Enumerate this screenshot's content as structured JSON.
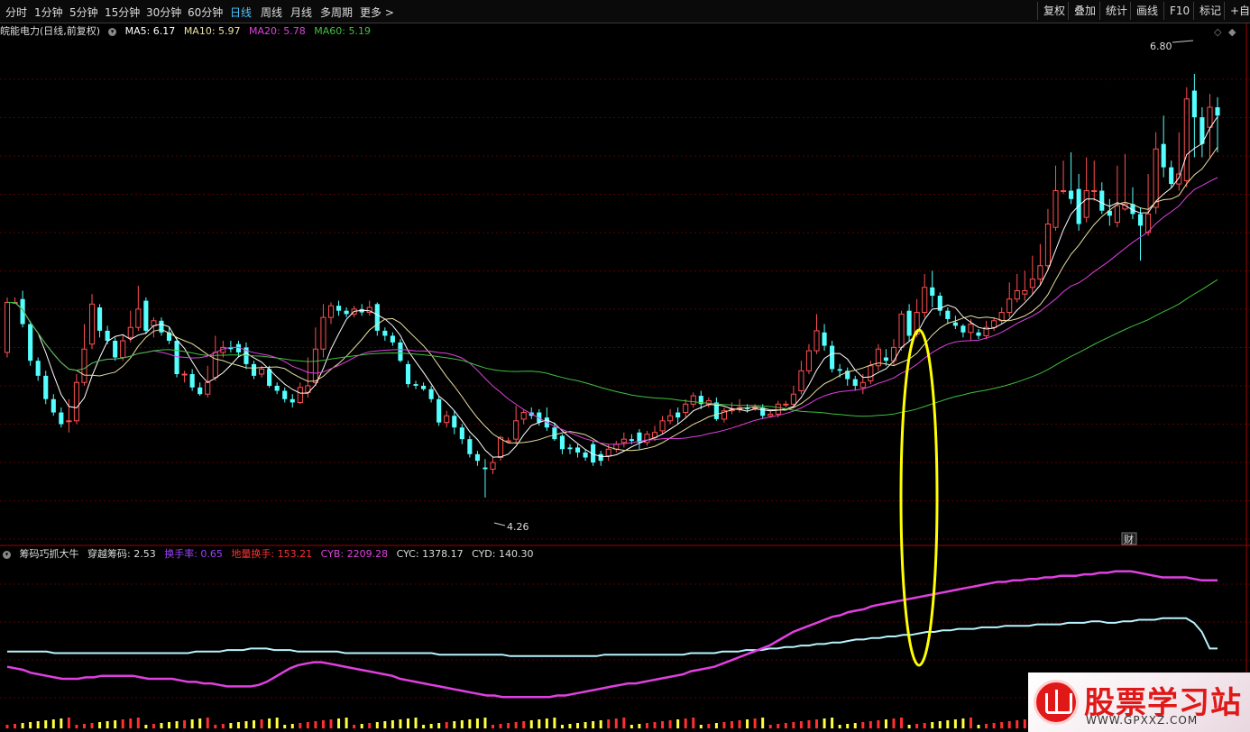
{
  "toolbar": {
    "periods": [
      "分时",
      "1分钟",
      "5分钟",
      "15分钟",
      "30分钟",
      "60分钟",
      "日线",
      "周线",
      "月线",
      "多周期",
      "更多 >"
    ],
    "active_period": "日线",
    "right_buttons": [
      "复权",
      "叠加",
      "统计",
      "画线",
      "F10",
      "标记",
      "+自选"
    ]
  },
  "chart_header": {
    "stock": "皖能电力(日线,前复权)",
    "ma_labels": [
      "MA5: 6.17",
      "MA10: 5.97",
      "MA20: 5.78",
      "MA60: 5.19"
    ],
    "colors": {
      "ma5": "#ffffff",
      "ma10": "#e8e0a0",
      "ma20": "#e040e0",
      "ma60": "#40c040"
    }
  },
  "indicator_header": {
    "name": "筹码巧抓大牛",
    "items": [
      {
        "label": "穿越筹码: ",
        "value": "2.53",
        "color": "#dddddd"
      },
      {
        "label": "换手率: ",
        "value": "0.65",
        "color": "#a040ff"
      },
      {
        "label": "地量换手: ",
        "value": "153.21",
        "color": "#ff3030"
      },
      {
        "label": "CYB: ",
        "value": "2209.28",
        "color": "#e040e0"
      },
      {
        "label": "CYC: ",
        "value": "1378.17",
        "color": "#dddddd"
      },
      {
        "label": "CYD: ",
        "value": "140.30",
        "color": "#dddddd"
      }
    ]
  },
  "annotations": {
    "high_label": "6.80",
    "low_label": "4.26",
    "finance_marker": "财"
  },
  "logo": {
    "name": "股票学习站",
    "url": "WWW.GPXXZ.COM"
  },
  "chart_data": {
    "type": "candlestick",
    "title": "皖能电力(日线,前复权)",
    "price_range": [
      4.0,
      7.0
    ],
    "colors": {
      "up": "#ff5050",
      "down": "#54ffff"
    },
    "candles": [
      [
        5.13,
        5.43,
        5.46,
        5.1
      ],
      [
        5.43,
        5.43,
        5.46,
        5.43
      ],
      [
        5.45,
        5.3,
        5.5,
        5.28
      ],
      [
        5.3,
        5.08,
        5.32,
        5.05
      ],
      [
        5.08,
        4.99,
        5.1,
        4.96
      ],
      [
        4.99,
        4.85,
        5.02,
        4.82
      ],
      [
        4.85,
        4.77,
        4.88,
        4.75
      ],
      [
        4.77,
        4.7,
        4.8,
        4.68
      ],
      [
        4.72,
        4.72,
        4.85,
        4.65
      ],
      [
        4.72,
        4.95,
        5.0,
        4.7
      ],
      [
        4.95,
        5.15,
        5.3,
        4.93
      ],
      [
        5.18,
        5.42,
        5.48,
        5.15
      ],
      [
        5.4,
        5.26,
        5.42,
        5.22
      ],
      [
        5.26,
        5.2,
        5.29,
        5.18
      ],
      [
        5.2,
        5.1,
        5.22,
        5.08
      ],
      [
        5.1,
        5.2,
        5.24,
        5.08
      ],
      [
        5.22,
        5.28,
        5.38,
        5.19
      ],
      [
        5.28,
        5.39,
        5.53,
        5.26
      ],
      [
        5.44,
        5.26,
        5.46,
        5.24
      ],
      [
        5.29,
        5.32,
        5.34,
        5.22
      ],
      [
        5.32,
        5.25,
        5.34,
        5.23
      ],
      [
        5.25,
        5.2,
        5.28,
        5.18
      ],
      [
        5.2,
        5.0,
        5.22,
        4.98
      ],
      [
        5.0,
        5.0,
        5.02,
        4.95
      ],
      [
        5.0,
        4.92,
        5.03,
        4.9
      ],
      [
        4.92,
        4.88,
        4.95,
        4.87
      ],
      [
        4.88,
        4.95,
        5.05,
        4.86
      ],
      [
        4.98,
        5.13,
        5.23,
        4.96
      ],
      [
        5.13,
        5.16,
        5.2,
        5.1
      ],
      [
        5.16,
        5.15,
        5.2,
        5.13
      ],
      [
        5.18,
        5.13,
        5.2,
        5.1
      ],
      [
        5.16,
        5.06,
        5.19,
        5.03
      ],
      [
        5.06,
        4.99,
        5.08,
        4.97
      ],
      [
        5.0,
        5.03,
        5.05,
        4.98
      ],
      [
        5.03,
        4.93,
        5.05,
        4.92
      ],
      [
        4.93,
        4.9,
        4.95,
        4.88
      ],
      [
        4.9,
        4.85,
        4.92,
        4.83
      ],
      [
        4.85,
        4.83,
        4.88,
        4.8
      ],
      [
        4.83,
        4.92,
        4.95,
        4.82
      ],
      [
        4.89,
        4.93,
        5.1,
        4.86
      ],
      [
        4.95,
        5.15,
        5.28,
        4.93
      ],
      [
        5.15,
        5.34,
        5.42,
        5.1
      ],
      [
        5.34,
        5.41,
        5.43,
        5.3
      ],
      [
        5.41,
        5.38,
        5.44,
        5.35
      ],
      [
        5.38,
        5.36,
        5.4,
        5.34
      ],
      [
        5.36,
        5.39,
        5.41,
        5.34
      ],
      [
        5.39,
        5.37,
        5.42,
        5.35
      ],
      [
        5.37,
        5.4,
        5.44,
        5.35
      ],
      [
        5.42,
        5.26,
        5.43,
        5.23
      ],
      [
        5.26,
        5.23,
        5.28,
        5.2
      ],
      [
        5.23,
        5.19,
        5.25,
        5.17
      ],
      [
        5.19,
        5.08,
        5.21,
        5.07
      ],
      [
        5.06,
        4.94,
        5.08,
        4.92
      ],
      [
        4.94,
        4.93,
        4.96,
        4.91
      ],
      [
        4.93,
        4.91,
        4.95,
        4.9
      ],
      [
        4.91,
        4.85,
        4.93,
        4.83
      ],
      [
        4.85,
        4.71,
        4.87,
        4.69
      ],
      [
        4.71,
        4.75,
        4.78,
        4.68
      ],
      [
        4.75,
        4.68,
        4.78,
        4.64
      ],
      [
        4.68,
        4.61,
        4.7,
        4.58
      ],
      [
        4.61,
        4.52,
        4.63,
        4.5
      ],
      [
        4.52,
        4.48,
        4.54,
        4.45
      ],
      [
        4.44,
        4.43,
        4.49,
        4.26
      ],
      [
        4.43,
        4.47,
        4.5,
        4.4
      ],
      [
        4.5,
        4.62,
        4.63,
        4.48
      ],
      [
        4.6,
        4.6,
        4.62,
        4.59
      ],
      [
        4.61,
        4.72,
        4.81,
        4.58
      ],
      [
        4.73,
        4.77,
        4.79,
        4.7
      ],
      [
        4.77,
        4.75,
        4.8,
        4.73
      ],
      [
        4.77,
        4.71,
        4.79,
        4.69
      ],
      [
        4.74,
        4.68,
        4.8,
        4.66
      ],
      [
        4.68,
        4.61,
        4.71,
        4.6
      ],
      [
        4.63,
        4.55,
        4.64,
        4.52
      ],
      [
        4.56,
        4.55,
        4.58,
        4.52
      ],
      [
        4.56,
        4.53,
        4.58,
        4.5
      ],
      [
        4.53,
        4.5,
        4.55,
        4.48
      ],
      [
        4.58,
        4.47,
        4.6,
        4.45
      ],
      [
        4.52,
        4.48,
        4.54,
        4.45
      ],
      [
        4.51,
        4.55,
        4.58,
        4.48
      ],
      [
        4.55,
        4.58,
        4.6,
        4.53
      ],
      [
        4.59,
        4.61,
        4.65,
        4.56
      ],
      [
        4.61,
        4.6,
        4.64,
        4.58
      ],
      [
        4.65,
        4.59,
        4.67,
        4.55
      ],
      [
        4.59,
        4.64,
        4.66,
        4.57
      ],
      [
        4.62,
        4.65,
        4.69,
        4.6
      ],
      [
        4.66,
        4.72,
        4.75,
        4.64
      ],
      [
        4.72,
        4.75,
        4.79,
        4.7
      ],
      [
        4.77,
        4.74,
        4.8,
        4.7
      ],
      [
        4.77,
        4.82,
        4.85,
        4.74
      ],
      [
        4.82,
        4.87,
        4.89,
        4.8
      ],
      [
        4.87,
        4.82,
        4.9,
        4.79
      ],
      [
        4.82,
        4.84,
        4.86,
        4.8
      ],
      [
        4.83,
        4.73,
        4.86,
        4.72
      ],
      [
        4.73,
        4.78,
        4.8,
        4.71
      ],
      [
        4.78,
        4.79,
        4.83,
        4.76
      ],
      [
        4.79,
        4.8,
        4.85,
        4.77
      ],
      [
        4.8,
        4.79,
        4.82,
        4.77
      ],
      [
        4.8,
        4.8,
        4.82,
        4.78
      ],
      [
        4.8,
        4.75,
        4.82,
        4.73
      ],
      [
        4.75,
        4.76,
        4.78,
        4.74
      ],
      [
        4.76,
        4.82,
        4.84,
        4.74
      ],
      [
        4.82,
        4.82,
        4.84,
        4.8
      ],
      [
        4.82,
        4.88,
        4.93,
        4.8
      ],
      [
        4.9,
        5.02,
        5.08,
        4.88
      ],
      [
        5.02,
        5.14,
        5.18,
        5.0
      ],
      [
        5.14,
        5.26,
        5.36,
        5.12
      ],
      [
        5.25,
        5.17,
        5.3,
        5.14
      ],
      [
        5.17,
        5.03,
        5.2,
        5.01
      ],
      [
        5.03,
        5.02,
        5.06,
        4.98
      ],
      [
        5.02,
        4.97,
        5.04,
        4.93
      ],
      [
        4.97,
        4.93,
        4.99,
        4.9
      ],
      [
        4.92,
        4.95,
        5.0,
        4.88
      ],
      [
        4.96,
        5.05,
        5.08,
        4.94
      ],
      [
        5.05,
        5.15,
        5.18,
        5.02
      ],
      [
        5.1,
        5.08,
        5.15,
        5.05
      ],
      [
        5.08,
        5.16,
        5.21,
        5.05
      ],
      [
        5.16,
        5.36,
        5.38,
        5.14
      ],
      [
        5.38,
        5.23,
        5.42,
        5.2
      ],
      [
        5.24,
        5.37,
        5.45,
        5.22
      ],
      [
        5.37,
        5.52,
        5.6,
        5.34
      ],
      [
        5.52,
        5.47,
        5.62,
        5.4
      ],
      [
        5.47,
        5.38,
        5.49,
        5.35
      ],
      [
        5.38,
        5.33,
        5.4,
        5.3
      ],
      [
        5.31,
        5.29,
        5.35,
        5.27
      ],
      [
        5.29,
        5.25,
        5.3,
        5.22
      ],
      [
        5.25,
        5.3,
        5.33,
        5.2
      ],
      [
        5.25,
        5.23,
        5.27,
        5.21
      ],
      [
        5.23,
        5.28,
        5.32,
        5.21
      ],
      [
        5.28,
        5.32,
        5.34,
        5.26
      ],
      [
        5.32,
        5.37,
        5.4,
        5.3
      ],
      [
        5.37,
        5.45,
        5.55,
        5.34
      ],
      [
        5.45,
        5.5,
        5.6,
        5.43
      ],
      [
        5.48,
        5.5,
        5.62,
        5.44
      ],
      [
        5.52,
        5.57,
        5.71,
        5.48
      ],
      [
        5.57,
        5.65,
        5.78,
        5.53
      ],
      [
        5.65,
        5.9,
        5.99,
        5.62
      ],
      [
        5.88,
        6.1,
        6.25,
        5.86
      ],
      [
        6.1,
        6.1,
        6.28,
        6.08
      ],
      [
        6.1,
        6.05,
        6.33,
        6.02
      ],
      [
        6.11,
        5.9,
        6.2,
        5.86
      ],
      [
        5.94,
        6.1,
        6.3,
        5.91
      ],
      [
        6.1,
        6.1,
        6.28,
        6.04
      ],
      [
        6.1,
        5.98,
        6.15,
        5.96
      ],
      [
        5.98,
        5.95,
        6.05,
        5.89
      ],
      [
        5.91,
        6.01,
        6.25,
        5.88
      ],
      [
        5.99,
        6.02,
        6.32,
        5.98
      ],
      [
        6.02,
        5.96,
        6.12,
        5.93
      ],
      [
        5.96,
        5.89,
        6.0,
        5.68
      ],
      [
        5.85,
        5.96,
        6.2,
        5.83
      ],
      [
        6.0,
        6.35,
        6.45,
        5.96
      ],
      [
        6.38,
        6.24,
        6.55,
        6.18
      ],
      [
        6.24,
        6.14,
        6.28,
        6.12
      ],
      [
        6.14,
        6.2,
        6.45,
        6.1
      ],
      [
        6.16,
        6.65,
        6.72,
        6.12
      ],
      [
        6.7,
        6.54,
        6.8,
        6.3
      ],
      [
        6.54,
        6.38,
        6.6,
        6.3
      ],
      [
        6.48,
        6.6,
        6.68,
        6.3
      ],
      [
        6.6,
        6.55,
        6.66,
        6.33
      ]
    ],
    "ma_series": [
      {
        "name": "MA5",
        "current": 6.17,
        "color": "#ffffff"
      },
      {
        "name": "MA10",
        "current": 5.97,
        "color": "#e8e0a0"
      },
      {
        "name": "MA20",
        "current": 5.78,
        "color": "#e040e0"
      },
      {
        "name": "MA60",
        "current": 5.19,
        "color": "#40c040"
      }
    ],
    "indicator": {
      "range": [
        0,
        100
      ],
      "cyc": [
        40,
        40,
        40,
        40,
        40,
        40,
        39,
        39,
        39,
        39,
        39,
        39,
        39,
        39,
        39,
        39,
        39,
        39,
        39,
        39,
        39,
        39,
        39,
        39,
        40,
        40,
        40,
        40,
        41,
        41,
        41,
        42,
        42,
        42,
        41,
        41,
        41,
        40,
        40,
        40,
        40,
        40,
        40,
        39,
        39,
        39,
        39,
        39,
        39,
        39,
        39,
        39,
        39,
        39,
        39,
        38,
        38,
        38,
        38,
        38,
        38,
        38,
        38,
        38,
        37,
        37,
        37,
        37,
        37,
        37,
        37,
        37,
        37,
        37,
        37,
        37,
        38,
        38,
        38,
        38,
        38,
        38,
        38,
        38,
        38,
        38,
        38,
        39,
        39,
        39,
        39,
        40,
        40,
        40,
        41,
        41,
        41,
        42,
        42,
        43,
        43,
        44,
        44,
        45,
        45,
        46,
        46,
        47,
        48,
        48,
        49,
        49,
        50,
        50,
        51,
        51,
        52,
        53,
        53,
        54,
        54,
        55,
        55,
        55,
        56,
        56,
        56,
        57,
        57,
        57,
        57,
        58,
        58,
        58,
        58,
        59,
        59,
        59,
        60,
        60,
        59,
        59,
        60,
        60,
        61,
        61,
        61,
        62,
        62,
        62,
        62,
        59,
        53,
        42,
        42
      ],
      "cyb": [
        30,
        29,
        28,
        26,
        25,
        24,
        23,
        22,
        22,
        22,
        23,
        23,
        24,
        24,
        24,
        24,
        24,
        23,
        22,
        22,
        22,
        22,
        21,
        20,
        20,
        19,
        19,
        18,
        17,
        17,
        17,
        17,
        18,
        20,
        23,
        26,
        29,
        31,
        32,
        33,
        33,
        32,
        31,
        30,
        29,
        28,
        27,
        26,
        25,
        24,
        22,
        21,
        20,
        19,
        18,
        17,
        16,
        15,
        14,
        13,
        12,
        11,
        11,
        10,
        10,
        10,
        10,
        10,
        10,
        10,
        11,
        11,
        12,
        13,
        14,
        15,
        16,
        17,
        18,
        19,
        19,
        20,
        21,
        22,
        23,
        24,
        25,
        27,
        28,
        29,
        30,
        32,
        34,
        36,
        38,
        40,
        42,
        44,
        47,
        50,
        53,
        55,
        57,
        59,
        61,
        63,
        64,
        66,
        67,
        68,
        70,
        71,
        72,
        73,
        74,
        75,
        76,
        77,
        78,
        79,
        80,
        81,
        82,
        83,
        84,
        85,
        86,
        86,
        87,
        87,
        88,
        88,
        89,
        89,
        90,
        90,
        90,
        91,
        91,
        92,
        92,
        93,
        93,
        93,
        92,
        91,
        90,
        89,
        89,
        89,
        89,
        88,
        87,
        87,
        87
      ]
    },
    "volume_colors_note": "bottom strip volume bars"
  }
}
